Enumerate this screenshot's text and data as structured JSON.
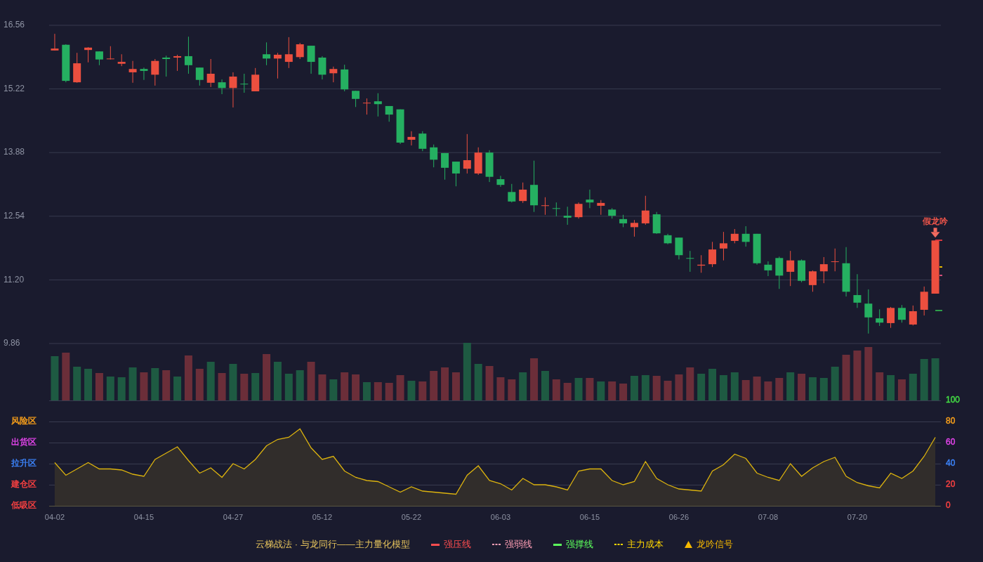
{
  "price_chart": {
    "end_marks": [
      {
        "color": "#d9363e"
      },
      {
        "color": "#e6b800"
      },
      {
        "color": "#d64f7a"
      },
      {
        "color": "#2e9e4a"
      }
    ],
    "chart_data": {
      "type": "candlestick",
      "grid": true,
      "ylim": [
        9.86,
        16.56
      ],
      "yticks": [
        16.56,
        15.22,
        13.88,
        12.54,
        {
          "value": 11.2,
          "label": "11.20"
        },
        9.86
      ],
      "categories": [
        null,
        null,
        null,
        null,
        null,
        null,
        null,
        null,
        null,
        null,
        null,
        null,
        null,
        null,
        null,
        null,
        null,
        null,
        null,
        null,
        null,
        null,
        null,
        null,
        null,
        null,
        null,
        null,
        null,
        null,
        null,
        null,
        null,
        null,
        null,
        null,
        null,
        null,
        null,
        null,
        null,
        null,
        null,
        null,
        null,
        null,
        null,
        null,
        null,
        null,
        null,
        null,
        null,
        null,
        null,
        null,
        null,
        null,
        null,
        null,
        null,
        null,
        null,
        null,
        null,
        null,
        null,
        null,
        null,
        null,
        null,
        null,
        null,
        null,
        null,
        null,
        null,
        null,
        null,
        null
      ],
      "ohlc": [
        [
          16.03,
          16.38,
          16.03,
          16.07
        ],
        [
          16.15,
          16.16,
          15.36,
          15.39
        ],
        [
          15.36,
          15.98,
          15.35,
          15.76
        ],
        [
          16.04,
          16.1,
          15.78,
          16.09
        ],
        [
          16.01,
          16.01,
          15.72,
          15.84
        ],
        [
          15.85,
          16.12,
          15.84,
          15.86
        ],
        [
          15.75,
          15.95,
          15.7,
          15.79
        ],
        [
          15.57,
          15.81,
          15.35,
          15.64
        ],
        [
          15.64,
          15.67,
          15.41,
          15.6
        ],
        [
          15.52,
          15.85,
          15.29,
          15.81
        ],
        [
          15.88,
          15.92,
          15.48,
          15.85
        ],
        [
          15.88,
          15.94,
          15.6,
          15.91
        ],
        [
          15.91,
          16.32,
          15.54,
          15.72
        ],
        [
          15.67,
          15.67,
          15.29,
          15.41
        ],
        [
          15.35,
          15.85,
          15.26,
          15.54
        ],
        [
          15.36,
          15.42,
          15.11,
          15.24
        ],
        [
          15.24,
          15.57,
          14.83,
          15.48
        ],
        [
          15.33,
          15.54,
          15.14,
          15.32
        ],
        [
          15.17,
          15.66,
          15.17,
          15.52
        ],
        [
          15.95,
          16.2,
          15.72,
          15.86
        ],
        [
          15.86,
          15.98,
          15.44,
          15.94
        ],
        [
          15.79,
          16.31,
          15.66,
          15.95
        ],
        [
          15.89,
          16.19,
          15.85,
          16.16
        ],
        [
          16.13,
          16.13,
          15.54,
          15.79
        ],
        [
          15.88,
          15.91,
          15.42,
          15.52
        ],
        [
          15.55,
          15.69,
          15.36,
          15.64
        ],
        [
          15.63,
          15.73,
          15.17,
          15.21
        ],
        [
          15.18,
          15.18,
          14.84,
          15.01
        ],
        [
          14.92,
          15.02,
          14.68,
          14.93
        ],
        [
          14.96,
          15.13,
          14.64,
          14.9
        ],
        [
          14.86,
          14.86,
          14.53,
          14.68
        ],
        [
          14.79,
          14.79,
          14.06,
          14.09
        ],
        [
          14.15,
          14.33,
          14.03,
          14.21
        ],
        [
          14.28,
          14.33,
          13.91,
          13.96
        ],
        [
          13.99,
          14.05,
          13.57,
          13.73
        ],
        [
          13.87,
          13.87,
          13.31,
          13.56
        ],
        [
          13.69,
          13.69,
          13.17,
          13.44
        ],
        [
          13.54,
          14.27,
          13.44,
          13.72
        ],
        [
          13.44,
          13.99,
          13.41,
          13.88
        ],
        [
          13.88,
          13.93,
          13.26,
          13.37
        ],
        [
          13.32,
          13.39,
          13.16,
          13.2
        ],
        [
          13.05,
          13.22,
          12.83,
          12.85
        ],
        [
          12.86,
          13.25,
          12.82,
          13.1
        ],
        [
          13.2,
          13.71,
          12.63,
          12.77
        ],
        [
          12.76,
          12.94,
          12.57,
          12.77
        ],
        [
          12.71,
          12.83,
          12.54,
          12.7
        ],
        [
          12.55,
          12.74,
          12.36,
          12.51
        ],
        [
          12.52,
          12.83,
          12.49,
          12.8
        ],
        [
          12.89,
          13.1,
          12.71,
          12.83
        ],
        [
          12.76,
          12.88,
          12.57,
          12.82
        ],
        [
          12.68,
          12.71,
          12.49,
          12.55
        ],
        [
          12.48,
          12.57,
          12.31,
          12.39
        ],
        [
          12.31,
          12.46,
          12.11,
          12.4
        ],
        [
          12.39,
          12.97,
          12.36,
          12.66
        ],
        [
          12.58,
          12.63,
          12.17,
          12.18
        ],
        [
          12.14,
          12.17,
          11.95,
          11.97
        ],
        [
          12.09,
          12.09,
          11.63,
          11.72
        ],
        [
          11.66,
          11.81,
          11.37,
          11.65
        ],
        [
          11.5,
          11.72,
          11.35,
          11.52
        ],
        [
          11.53,
          12.0,
          11.47,
          11.84
        ],
        [
          11.86,
          12.21,
          11.61,
          11.97
        ],
        [
          12.02,
          12.27,
          11.97,
          12.17
        ],
        [
          12.17,
          12.33,
          11.9,
          12.0
        ],
        [
          12.17,
          12.17,
          11.52,
          11.55
        ],
        [
          11.52,
          11.59,
          11.28,
          11.4
        ],
        [
          11.66,
          11.69,
          11.01,
          11.29
        ],
        [
          11.37,
          11.81,
          11.07,
          11.61
        ],
        [
          11.61,
          11.63,
          11.15,
          11.18
        ],
        [
          11.09,
          11.4,
          10.95,
          11.38
        ],
        [
          11.38,
          11.68,
          11.13,
          11.53
        ],
        [
          11.58,
          11.86,
          11.38,
          11.59
        ],
        [
          11.55,
          11.89,
          10.85,
          10.95
        ],
        [
          10.88,
          11.32,
          10.61,
          10.72
        ],
        [
          10.7,
          11.0,
          10.07,
          10.41
        ],
        [
          10.39,
          10.58,
          10.23,
          10.3
        ],
        [
          10.29,
          10.63,
          10.19,
          10.61
        ],
        [
          10.61,
          10.67,
          10.3,
          10.36
        ],
        [
          10.26,
          10.66,
          10.24,
          10.54
        ],
        [
          10.57,
          11.06,
          10.45,
          10.95
        ],
        [
          10.91,
          12.03,
          10.91,
          12.03
        ]
      ],
      "annotations": [
        {
          "y": 12.03,
          "text": "假龙吟"
        }
      ]
    }
  },
  "indicator_chart": {
    "levels": [
      {
        "color": "#44e044"
      },
      {
        "zone": "风险区",
        "color": "#ffa31a"
      },
      {
        "zone": "出货区",
        "color": "#e845f0"
      },
      {
        "zone": "拉升区",
        "color": "#3d86ff"
      },
      {
        "zone": "建仓区",
        "color": "#ff4242"
      },
      {
        "zone": "低吸区",
        "color": "#ff4242"
      }
    ],
    "chart_data": {
      "type": "area",
      "grid": true,
      "ylim": [
        0,
        100
      ],
      "yticks": [
        100,
        80,
        60,
        40,
        20,
        0
      ],
      "categories": [
        "04-02",
        null,
        null,
        null,
        null,
        null,
        null,
        null,
        "04-15",
        null,
        null,
        null,
        null,
        null,
        null,
        null,
        "04-27",
        null,
        null,
        null,
        null,
        null,
        null,
        null,
        "05-12",
        null,
        null,
        null,
        null,
        null,
        null,
        null,
        "05-22",
        null,
        null,
        null,
        null,
        null,
        null,
        null,
        "06-03",
        null,
        null,
        null,
        null,
        null,
        null,
        null,
        "06-15",
        null,
        null,
        null,
        null,
        null,
        null,
        null,
        "06-26",
        null,
        null,
        null,
        null,
        null,
        null,
        null,
        "07-08",
        null,
        null,
        null,
        null,
        null,
        null,
        null,
        "07-20",
        null,
        null,
        null,
        null,
        null,
        null,
        null
      ],
      "series": [
        {
          "color": "#dcb30e",
          "values": [
            41,
            29,
            35,
            41,
            35,
            35,
            34,
            30,
            28,
            44,
            50,
            56,
            43,
            31,
            36,
            27,
            40,
            35,
            44,
            57,
            63,
            65,
            73,
            55,
            44,
            47,
            33,
            27,
            24,
            23,
            18,
            13,
            18,
            14,
            13,
            12,
            11,
            29,
            38,
            24,
            21,
            15,
            26,
            20,
            20,
            18,
            15,
            33,
            35,
            35,
            24,
            20,
            23,
            42,
            26,
            20,
            16,
            15,
            14,
            33,
            39,
            49,
            45,
            31,
            27,
            24,
            40,
            28,
            36,
            42,
            46,
            28,
            22,
            19,
            17,
            31,
            26,
            33,
            47,
            65
          ]
        }
      ]
    }
  },
  "legend": {
    "title": "云梯战法 · 与龙同行——主力量化模型",
    "items": [
      {
        "label": "强压线",
        "color": "#ff4d4f",
        "kind": "solid"
      },
      {
        "label": "强弱线",
        "color": "#ff9eb5",
        "kind": "dashed"
      },
      {
        "label": "强撑线",
        "color": "#5cff5c",
        "kind": "solid"
      },
      {
        "label": "主力成本",
        "color": "#ffd700",
        "kind": "dashed"
      },
      {
        "label": "龙吟信号",
        "color": "#f5b800",
        "kind": "triangle"
      }
    ]
  }
}
